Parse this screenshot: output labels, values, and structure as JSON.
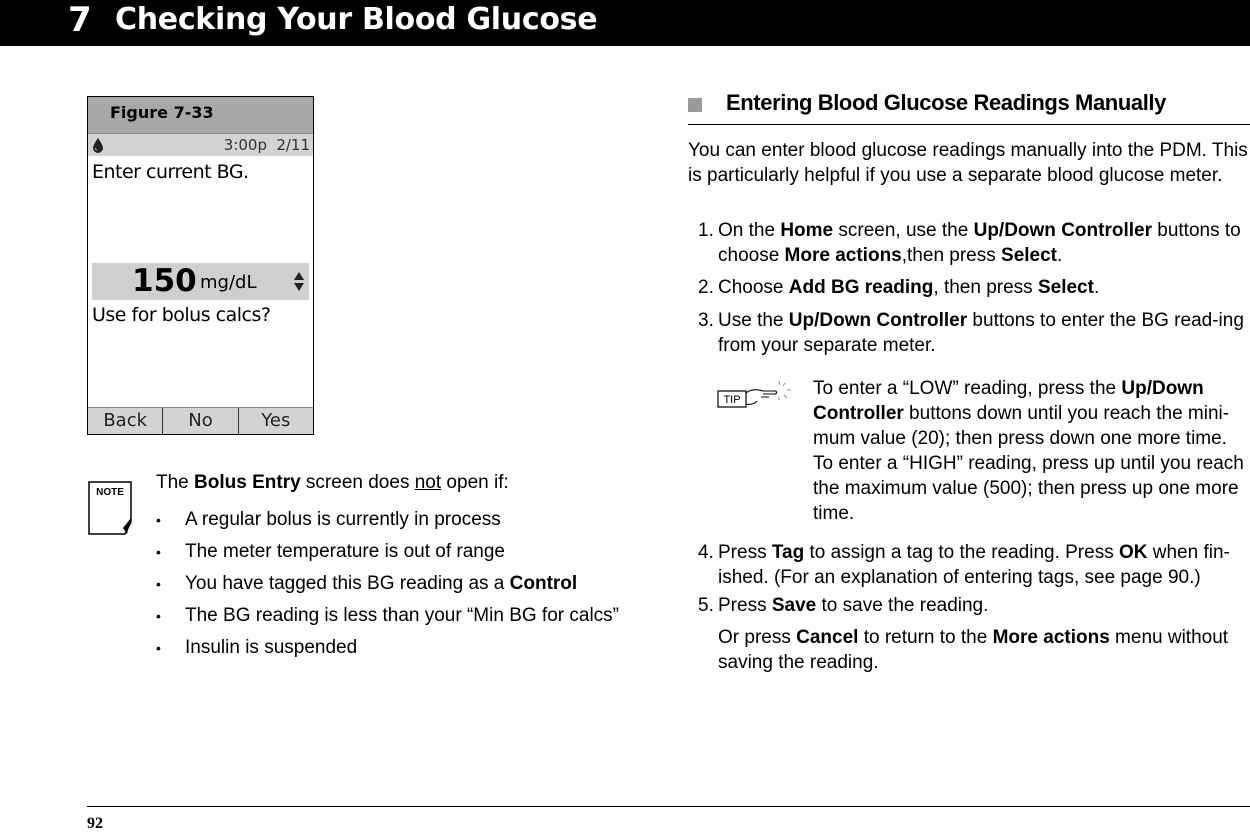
{
  "header": {
    "chapter_number": "7",
    "chapter_title": "Checking Your Blood Glucose"
  },
  "figure": {
    "caption": "Figure 7-33",
    "status_time": "3:00p",
    "status_date": "2/11",
    "prompt": "Enter current BG.",
    "bg_value": "150",
    "bg_unit": "mg/dL",
    "question": "Use for bolus calcs?",
    "softkeys": [
      "Back",
      "No",
      "Yes"
    ]
  },
  "note": {
    "icon_label": "NOTE",
    "intro_pre": "The ",
    "intro_bold": "Bolus Entry",
    "intro_mid": " screen does ",
    "intro_underline": "not",
    "intro_post": " open if:",
    "items": [
      {
        "text": "A regular bolus is currently in process",
        "bold": ""
      },
      {
        "text": "The meter temperature is out of range",
        "bold": ""
      },
      {
        "text": "You have tagged this BG reading as a ",
        "bold": "Control"
      },
      {
        "text": "The BG reading is less than your “Min BG for calcs”",
        "bold": ""
      },
      {
        "text": "Insulin is suspended",
        "bold": ""
      }
    ]
  },
  "section": {
    "heading": "Entering Blood Glucose Readings Manually",
    "intro": "You can enter blood glucose readings manually into the PDM. This is particularly helpful if you use a separate blood glucose meter.",
    "steps": [
      {
        "num": "1.",
        "parts": [
          "On the ",
          "Home",
          " screen, use the ",
          "Up/Down Controller",
          " buttons to choose ",
          "More actions",
          ",then press ",
          "Select",
          "."
        ]
      },
      {
        "num": "2.",
        "parts": [
          "Choose ",
          "Add BG reading",
          ", then press ",
          "Select",
          "."
        ]
      },
      {
        "num": "3.",
        "parts": [
          "Use the ",
          "Up/Down Controller",
          " buttons to enter the BG read-ing from your separate meter."
        ]
      },
      {
        "num": "4.",
        "parts": [
          "Press ",
          "Tag",
          " to assign a tag to the reading. Press ",
          "OK",
          " when fin-ished. (For an explanation of entering tags, see page 90.)"
        ]
      },
      {
        "num": "5.",
        "parts": [
          "Press ",
          "Save",
          " to save the reading."
        ]
      }
    ],
    "step5_extra": [
      "Or press ",
      "Cancel",
      " to return to the ",
      "More actions",
      " menu without saving the reading."
    ],
    "tip": {
      "icon_label": "TIP",
      "parts": [
        "To enter a “LOW” reading, press the ",
        "Up/Down Controller",
        " buttons down until you reach the mini-mum value (20); then press down one more time. To enter a “HIGH” reading, press up until you reach the maximum value (500); then press up one more time."
      ]
    }
  },
  "footer": {
    "page_number": "92"
  }
}
